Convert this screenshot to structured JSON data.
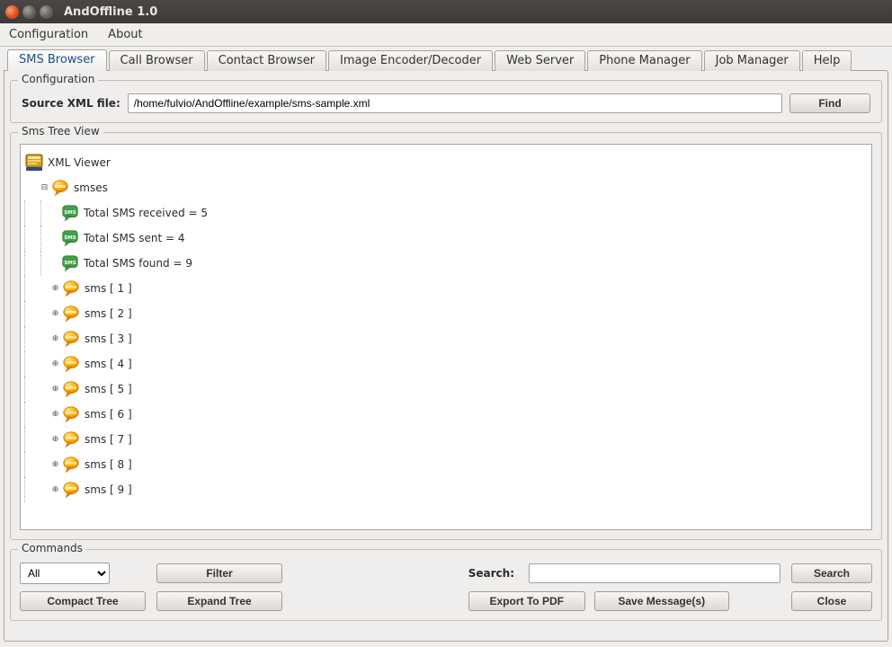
{
  "window": {
    "title": "AndOffline 1.0"
  },
  "menubar": {
    "configuration": "Configuration",
    "about": "About"
  },
  "tabs": {
    "sms_browser": "SMS Browser",
    "call_browser": "Call Browser",
    "contact_browser": "Contact Browser",
    "image_encoder_decoder": "Image Encoder/Decoder",
    "web_server": "Web Server",
    "phone_manager": "Phone Manager",
    "job_manager": "Job Manager",
    "help": "Help"
  },
  "configbox": {
    "legend": "Configuration",
    "source_label": "Source XML file:",
    "source_value": "/home/fulvio/AndOffline/example/sms-sample.xml",
    "find_btn": "Find"
  },
  "treeview": {
    "legend": "Sms Tree View",
    "root": "XML Viewer",
    "smses": "smses",
    "total_received": "Total SMS received = 5",
    "total_sent": "Total SMS sent = 4",
    "total_found": "Total SMS found = 9",
    "items": [
      "sms [ 1 ]",
      "sms [ 2 ]",
      "sms [ 3 ]",
      "sms [ 4 ]",
      "sms [ 5 ]",
      "sms [ 6 ]",
      "sms [ 7 ]",
      "sms [ 8 ]",
      "sms [ 9 ]"
    ]
  },
  "commands": {
    "legend": "Commands",
    "filter_sel": "All",
    "filter_btn": "Filter",
    "search_label": "Search:",
    "search_value": "",
    "search_btn": "Search",
    "compact_btn": "Compact Tree",
    "expand_btn": "Expand Tree",
    "export_btn": "Export To PDF",
    "savemsg_btn": "Save Message(s)",
    "close_btn": "Close"
  }
}
